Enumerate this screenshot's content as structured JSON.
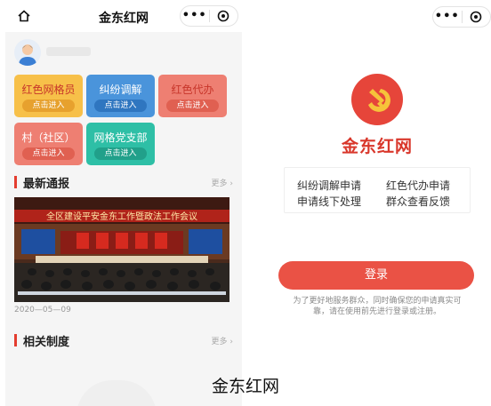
{
  "left": {
    "nav_title": "金东红网",
    "tiles": [
      {
        "label": "红色网格员",
        "button": "点击进入"
      },
      {
        "label": "纠纷调解",
        "button": "点击进入"
      },
      {
        "label": "红色代办",
        "button": "点击进入"
      },
      {
        "label": "村（社区）",
        "button": "点击进入"
      },
      {
        "label": "网格党支部",
        "button": "点击进入"
      }
    ],
    "news": {
      "title": "最新通报",
      "more": "更多 ›",
      "date": "2020—05—09",
      "banner": "全区建设平安金东工作暨政法工作会议"
    },
    "rules": {
      "title": "相关制度",
      "more": "更多 ›"
    }
  },
  "right": {
    "brand": "金东红网",
    "services": [
      "纠纷调解申请",
      "红色代办申请",
      "申请线下处理",
      "群众查看反馈"
    ],
    "login": "登录",
    "notice": "为了更好地服务群众，同时确保您的申请真实可靠，请在使用前先进行登录或注册。"
  },
  "caption": "金东红网",
  "icons": {
    "home": "home-icon",
    "more": "more-dots-icon",
    "close": "target-icon",
    "logo": "party-emblem-icon"
  },
  "colors": {
    "brand_red": "#e43d2f",
    "yellow": "#f7c049",
    "blue": "#4a94db",
    "salmon": "#ee7f72",
    "teal": "#2ebfa6"
  }
}
